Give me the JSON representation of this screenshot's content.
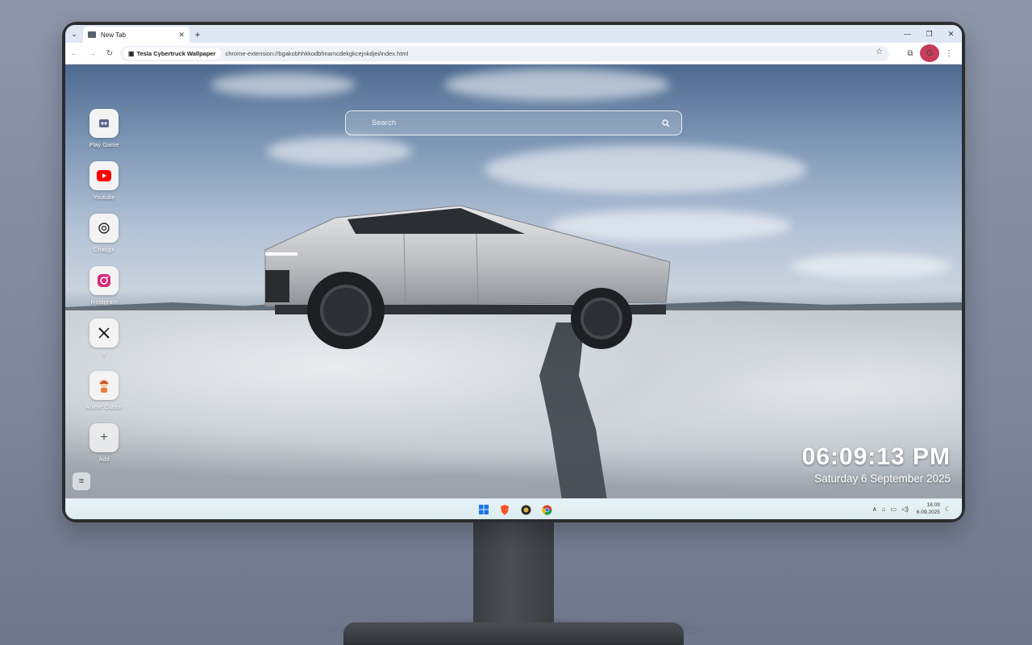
{
  "browser": {
    "tab_title": "New Tab",
    "site_chip": "Tesla Cybertruck Wallpaper",
    "url": "chrome-extension://bgakobhhkkodbhnamcdekgkcejnkdjei/index.html",
    "profile_initial": "G"
  },
  "search": {
    "placeholder": "Search"
  },
  "shortcuts": [
    {
      "label": "Play Game",
      "icon": "game-icon"
    },
    {
      "label": "Youtube",
      "icon": "youtube-icon"
    },
    {
      "label": "Chatgpt",
      "icon": "chatgpt-icon"
    },
    {
      "label": "Instagram",
      "icon": "instagram-icon"
    },
    {
      "label": "X",
      "icon": "x-icon"
    },
    {
      "label": "Anime Cursor",
      "icon": "anime-cursor-icon"
    },
    {
      "label": "Add",
      "icon": "plus-icon"
    }
  ],
  "clock": {
    "time": "06:09:13 PM",
    "date": "Saturday 6 September 2025"
  },
  "taskbar": {
    "time": "18:09",
    "date": "6.09.2025"
  },
  "colors": {
    "youtube": "#ff0000",
    "instagram": "#d62976",
    "profile": "#c63c5a",
    "chrome_blue": "#1a73e8"
  }
}
